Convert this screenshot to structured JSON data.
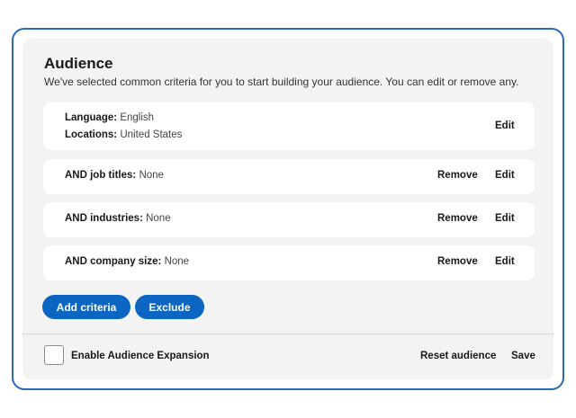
{
  "audience": {
    "title": "Audience",
    "subtitle": "We've selected common criteria for you to start building your audience. You can edit or remove any."
  },
  "criteria": [
    {
      "lines": [
        {
          "label": "Language:",
          "value": "English"
        },
        {
          "label": "Locations:",
          "value": "United States"
        }
      ],
      "edit_label": "Edit"
    },
    {
      "lines": [
        {
          "label": "AND job titles:",
          "value": "None"
        }
      ],
      "remove_label": "Remove",
      "edit_label": "Edit"
    },
    {
      "lines": [
        {
          "label": "AND industries:",
          "value": "None"
        }
      ],
      "remove_label": "Remove",
      "edit_label": "Edit"
    },
    {
      "lines": [
        {
          "label": "AND company size:",
          "value": "None"
        }
      ],
      "remove_label": "Remove",
      "edit_label": "Edit"
    }
  ],
  "actions": {
    "add_criteria_label": "Add criteria",
    "exclude_label": "Exclude"
  },
  "footer": {
    "expansion_label": "Enable Audience Expansion",
    "expansion_checked": false,
    "reset_label": "Reset audience",
    "save_label": "Save"
  },
  "colors": {
    "accent": "#0a66c2",
    "frame_border": "#2a6ab8",
    "panel_bg": "#f3f3f3"
  }
}
